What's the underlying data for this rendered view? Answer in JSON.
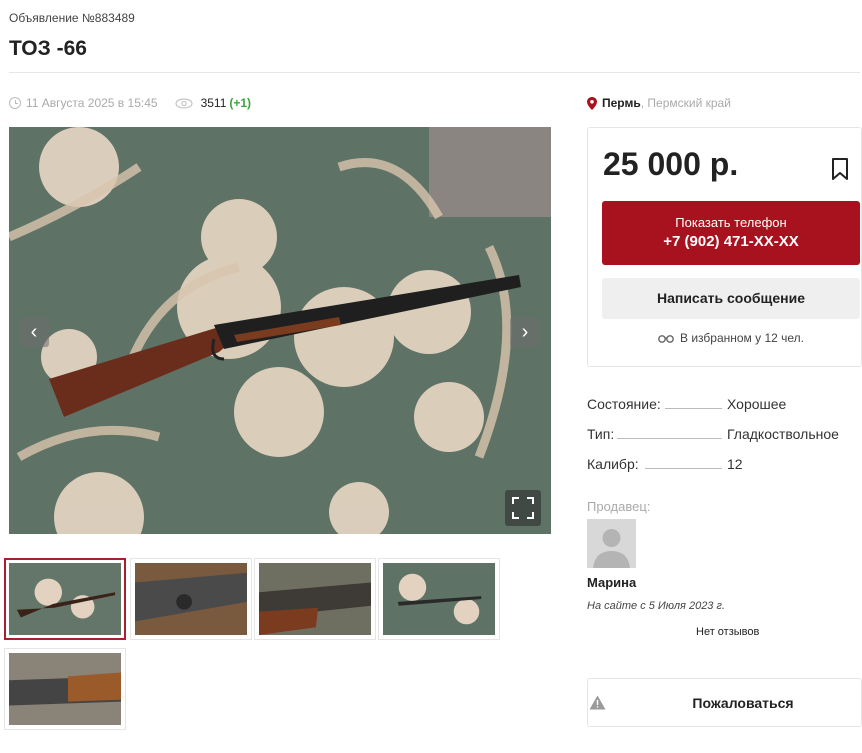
{
  "listing": {
    "ad_number": "Объявление №883489",
    "title": "ТОЗ -66",
    "date": "11 Августа 2025 в 15:45",
    "views": "3511",
    "views_delta": "(+1)"
  },
  "location": {
    "city": "Пермь",
    "region": ", Пермский край"
  },
  "gallery": {
    "prev_icon": "‹",
    "next_icon": "›",
    "thumbnails": [
      "thumb-1",
      "thumb-2",
      "thumb-3",
      "thumb-4",
      "thumb-5"
    ]
  },
  "price_card": {
    "price": "25 000 р.",
    "phone_label": "Показать телефон",
    "phone_number": "+7 (902) 471-XX-XX",
    "message_label": "Написать сообщение",
    "favorites_text": "В избранном у 12 чел."
  },
  "attributes": [
    {
      "key": "Состояние:",
      "value": "Хорошее"
    },
    {
      "key": "Тип:",
      "value": "Гладкоствольное"
    },
    {
      "key": "Калибр:",
      "value": "12"
    }
  ],
  "seller": {
    "label": "Продавец:",
    "name": "Марина",
    "since": "На сайте с 5 Июля 2023 г.",
    "reviews": "Нет отзывов"
  },
  "report": {
    "label": "Пожаловаться"
  },
  "colors": {
    "accent": "#a8121f",
    "views_delta": "#3aa53a",
    "muted": "#aaaaaa"
  }
}
